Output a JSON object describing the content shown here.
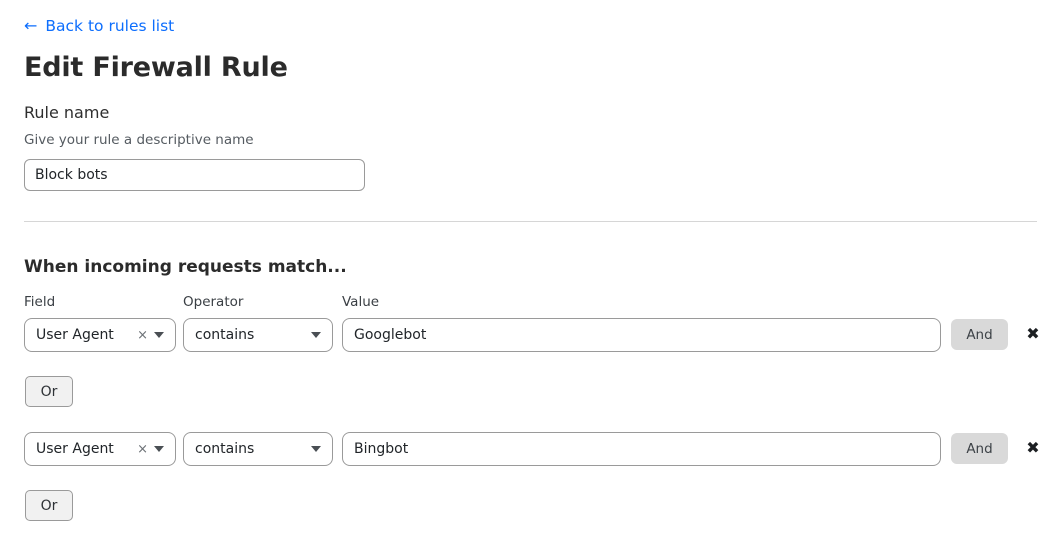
{
  "back_link": {
    "arrow_glyph": "←",
    "label": "Back to rules list"
  },
  "page_title": "Edit Firewall Rule",
  "rule_name": {
    "label": "Rule name",
    "help": "Give your rule a descriptive name",
    "value": "Block bots",
    "placeholder": "Rule name"
  },
  "match_section": {
    "heading": "When incoming requests match...",
    "columns": {
      "field": "Field",
      "operator": "Operator",
      "value": "Value"
    },
    "conditions": [
      {
        "field": "User Agent",
        "clear_glyph": "×",
        "operator": "contains",
        "value": "Googlebot",
        "value_placeholder": "Value",
        "and_label": "And",
        "remove_glyph": "✖"
      },
      {
        "field": "User Agent",
        "clear_glyph": "×",
        "operator": "contains",
        "value": "Bingbot",
        "value_placeholder": "Value",
        "and_label": "And",
        "remove_glyph": "✖"
      }
    ],
    "or_buttons": [
      {
        "label": "Or"
      },
      {
        "label": "Or"
      }
    ]
  },
  "colors": {
    "link_blue": "#0d6efd",
    "title_dark": "#2b2b2b",
    "border_gray": "#9a9a9a",
    "and_button_bg": "#d9d9d9",
    "or_button_bg": "#f1f1f1",
    "divider": "#d6d6d6"
  }
}
